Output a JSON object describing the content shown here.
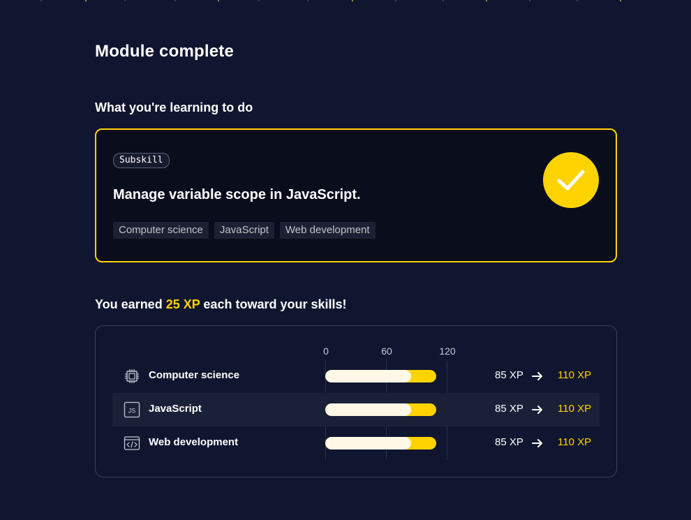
{
  "title": "Module complete",
  "learning_heading": "What you're learning to do",
  "skill_card": {
    "badge": "Subskill",
    "title": "Manage variable scope in JavaScript.",
    "tags": [
      "Computer science",
      "JavaScript",
      "Web development"
    ],
    "status_icon": "checkmark-icon",
    "accent_color": "#ffd300"
  },
  "earned": {
    "prefix": "You earned ",
    "amount": "25 XP",
    "suffix": " each toward your skills!"
  },
  "xp_scale": {
    "ticks": [
      "0",
      "60",
      "120"
    ],
    "max": 120
  },
  "skills": [
    {
      "label": "Computer science",
      "icon": "chip-icon",
      "from": "85 XP",
      "to": "110 XP",
      "from_value": 85,
      "to_value": 110
    },
    {
      "label": "JavaScript",
      "icon": "js-file-icon",
      "from": "85 XP",
      "to": "110 XP",
      "from_value": 85,
      "to_value": 110
    },
    {
      "label": "Web development",
      "icon": "code-window-icon",
      "from": "85 XP",
      "to": "110 XP",
      "from_value": 85,
      "to_value": 110
    }
  ]
}
